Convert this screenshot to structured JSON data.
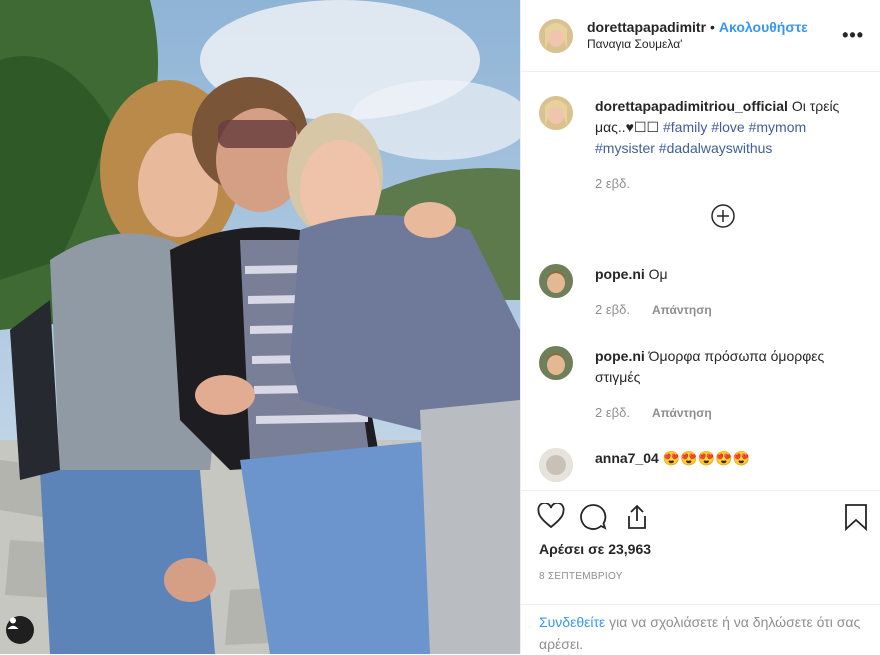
{
  "header": {
    "username": "dorettapapadimitr",
    "separator": "•",
    "follow_label": "Ακολουθήστε",
    "location": "Παναγια Σουμελα'",
    "more_icon": "more-horizontal-icon"
  },
  "caption": {
    "username": "dorettapapadimitriou_official",
    "text": "Οι τρείς μας..♥☐☐",
    "hashtags": [
      "#family",
      "#love",
      "#mymom",
      "#mysister",
      "#dadalwayswithus"
    ],
    "time": "2 εβδ.",
    "load_more_icon": "plus-circle-icon"
  },
  "comments": [
    {
      "username": "pope.ni",
      "text": "Ομ",
      "time": "2 εβδ.",
      "reply": "Απάντηση"
    },
    {
      "username": "pope.ni",
      "text": "Όμορφα πρόσωπα όμορφες στιγμές",
      "time": "2 εβδ.",
      "reply": "Απάντηση"
    },
    {
      "username": "anna7_04",
      "text": "😍😍😍😍😍"
    }
  ],
  "actions": {
    "icons": [
      "heart-icon",
      "comment-icon",
      "share-icon",
      "bookmark-icon"
    ],
    "likes": "Αρέσει σε 23,963",
    "date": "8 ΣΕΠΤΕΜΒΡΙΟΥ"
  },
  "login_prompt": {
    "link": "Συνδεθείτε",
    "text": " για να σχολιάσετε ή να δηλώσετε ότι σας αρέσει."
  },
  "colors": {
    "link": "#3897f0",
    "secondary": "#8e8e8e",
    "text": "#262626"
  }
}
